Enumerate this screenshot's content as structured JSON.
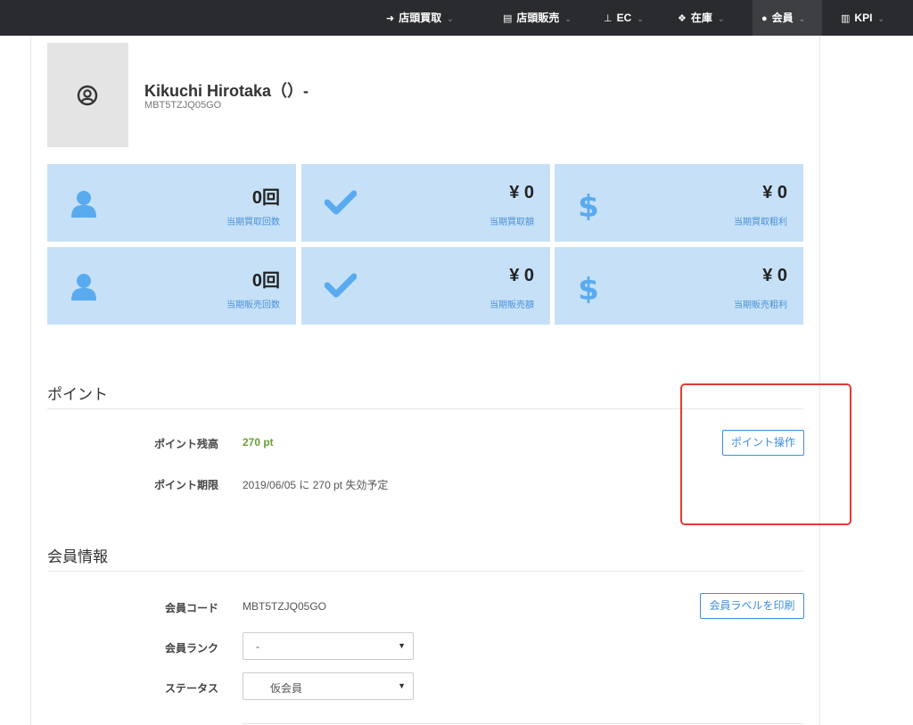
{
  "nav": {
    "items": [
      {
        "icon": "sign-in-icon",
        "label": "店頭買取"
      },
      {
        "icon": "cart-icon",
        "label": "店頭販売"
      },
      {
        "icon": "sitemap-icon",
        "label": "EC"
      },
      {
        "icon": "cubes-icon",
        "label": "在庫"
      },
      {
        "icon": "user-icon",
        "label": "会員"
      },
      {
        "icon": "chart-icon",
        "label": "KPI"
      }
    ],
    "chevron": "⌄"
  },
  "member": {
    "name": "Kikuchi Hirotaka（）-",
    "code": "MBT5TZJQ05GO"
  },
  "stats": [
    {
      "icon": "user-icon",
      "value": "0回",
      "label": "当期買取回数"
    },
    {
      "icon": "check-icon",
      "value": "¥ 0",
      "label": "当期買取額"
    },
    {
      "icon": "dollar-icon",
      "value": "¥ 0",
      "label": "当期買取粗利"
    },
    {
      "icon": "user-icon",
      "value": "0回",
      "label": "当期販売回数"
    },
    {
      "icon": "check-icon",
      "value": "¥ 0",
      "label": "当期販売額"
    },
    {
      "icon": "dollar-icon",
      "value": "¥ 0",
      "label": "当期販売粗利"
    }
  ],
  "points": {
    "title": "ポイント",
    "balance_label": "ポイント残高",
    "balance_value": "270 pt",
    "expiry_label": "ポイント期限",
    "expiry_value": "2019/06/05 に 270 pt 失効予定",
    "operate_button": "ポイント操作"
  },
  "info": {
    "title": "会員情報",
    "code_label": "会員コード",
    "code_value": "MBT5TZJQ05GO",
    "print_button": "会員ラベルを印刷",
    "rank_label": "会員ランク",
    "rank_value": "-",
    "status_label": "ステータス",
    "status_value": "仮会員"
  },
  "colors": {
    "stat_bg": "#c6e1f7",
    "stat_icon": "#5aaaf0",
    "accent": "#3d8ede",
    "points_green": "#6a9f33",
    "highlight": "#e53935"
  }
}
